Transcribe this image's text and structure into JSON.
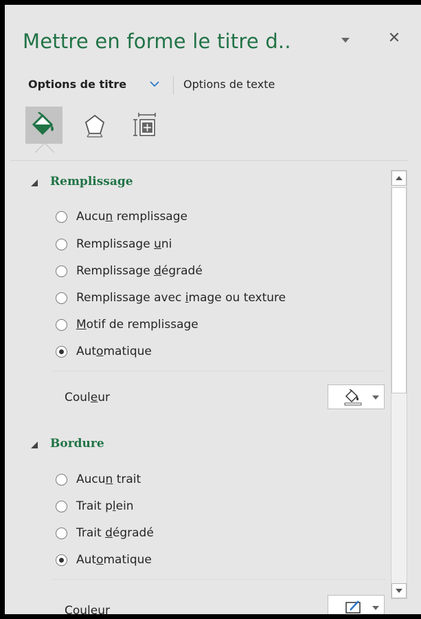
{
  "pane": {
    "title": "Mettre en forme le titre d..",
    "close_glyph": "✕",
    "accent_color": "#217346"
  },
  "option_tabs": {
    "active_label": "Options de titre",
    "second_label": "Options de texte"
  },
  "icon_tabs": [
    {
      "name": "fill-line-icon",
      "selected": true
    },
    {
      "name": "effects-pentagon-icon",
      "selected": false
    },
    {
      "name": "size-properties-icon",
      "selected": false
    }
  ],
  "sections": {
    "fill": {
      "header": "Remplissage",
      "options": [
        {
          "label_pre": "Aucu",
          "label_u": "n",
          "label_post": " remplissage",
          "checked": false
        },
        {
          "label_pre": "Remplissage ",
          "label_u": "u",
          "label_post": "ni",
          "checked": false
        },
        {
          "label_pre": "Remplissage ",
          "label_u": "d",
          "label_post": "égradé",
          "checked": false
        },
        {
          "label_pre": "Remplissage avec ",
          "label_u": "i",
          "label_post": "mage ou texture",
          "checked": false
        },
        {
          "label_pre": "",
          "label_u": "M",
          "label_post": "otif de remplissage",
          "checked": false
        },
        {
          "label_pre": "Aut",
          "label_u": "o",
          "label_post": "matique",
          "checked": true
        }
      ],
      "color_label_pre": "Coul",
      "color_label_u": "e",
      "color_label_post": "ur"
    },
    "border": {
      "header": "Bordure",
      "options": [
        {
          "label_pre": "Aucu",
          "label_u": "n",
          "label_post": " trait",
          "checked": false
        },
        {
          "label_pre": "Trait p",
          "label_u": "l",
          "label_post": "ein",
          "checked": false
        },
        {
          "label_pre": "Trait ",
          "label_u": "d",
          "label_post": "égradé",
          "checked": false
        },
        {
          "label_pre": "Aut",
          "label_u": "o",
          "label_post": "matique",
          "checked": true
        }
      ],
      "color_label_partial": "Couleur"
    }
  }
}
